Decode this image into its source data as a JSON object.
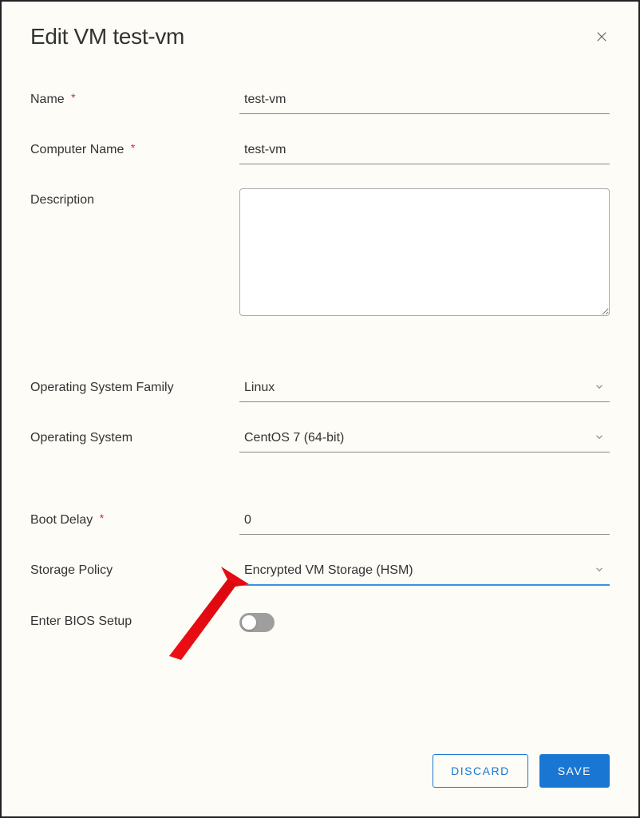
{
  "dialog": {
    "title": "Edit VM test-vm"
  },
  "fields": {
    "name": {
      "label": "Name",
      "value": "test-vm",
      "required": true
    },
    "computer_name": {
      "label": "Computer Name",
      "value": "test-vm",
      "required": true
    },
    "description": {
      "label": "Description",
      "value": ""
    },
    "os_family": {
      "label": "Operating System Family",
      "value": "Linux"
    },
    "os": {
      "label": "Operating System",
      "value": "CentOS 7 (64-bit)"
    },
    "boot_delay": {
      "label": "Boot Delay",
      "value": "0",
      "required": true
    },
    "storage_policy": {
      "label": "Storage Policy",
      "value": "Encrypted VM Storage (HSM)"
    },
    "enter_bios": {
      "label": "Enter BIOS Setup",
      "value": false
    }
  },
  "buttons": {
    "discard": "DISCARD",
    "save": "SAVE"
  },
  "required_marker": "*"
}
